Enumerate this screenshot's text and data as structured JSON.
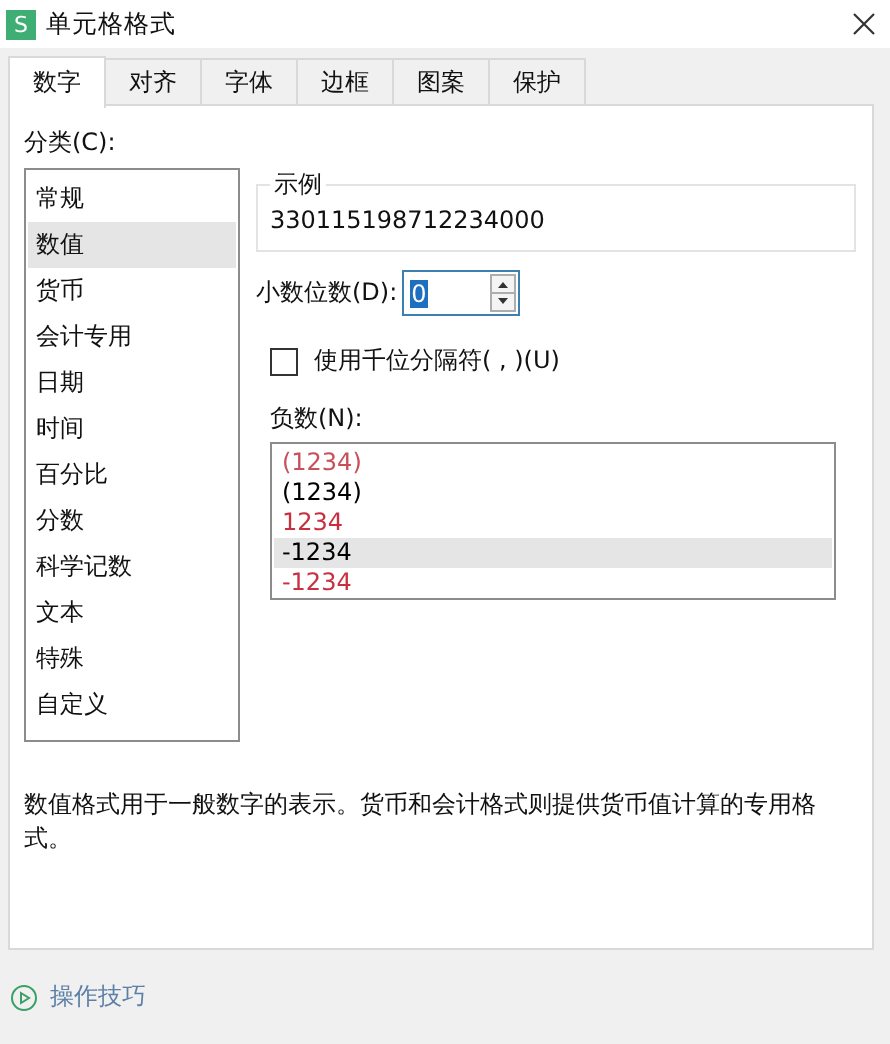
{
  "window": {
    "icon_letter": "S",
    "title": "单元格格式"
  },
  "tabs": [
    {
      "label": "数字",
      "selected": true
    },
    {
      "label": "对齐",
      "selected": false
    },
    {
      "label": "字体",
      "selected": false
    },
    {
      "label": "边框",
      "selected": false
    },
    {
      "label": "图案",
      "selected": false
    },
    {
      "label": "保护",
      "selected": false
    }
  ],
  "category": {
    "label": "分类(C):",
    "items": [
      {
        "label": "常规",
        "selected": false
      },
      {
        "label": "数值",
        "selected": true
      },
      {
        "label": "货币",
        "selected": false
      },
      {
        "label": "会计专用",
        "selected": false
      },
      {
        "label": "日期",
        "selected": false
      },
      {
        "label": "时间",
        "selected": false
      },
      {
        "label": "百分比",
        "selected": false
      },
      {
        "label": "分数",
        "selected": false
      },
      {
        "label": "科学记数",
        "selected": false
      },
      {
        "label": "文本",
        "selected": false
      },
      {
        "label": "特殊",
        "selected": false
      },
      {
        "label": "自定义",
        "selected": false
      }
    ]
  },
  "sample": {
    "label": "示例",
    "value": "330115198712234000"
  },
  "decimal_places": {
    "label": "小数位数(D):",
    "value": "0"
  },
  "thousands_separator": {
    "label": "使用千位分隔符( , )(U)",
    "checked": false
  },
  "negative_numbers": {
    "label": "负数(N):",
    "items": [
      {
        "text": "(1234)",
        "color": "#c8505a",
        "selected": false
      },
      {
        "text": "(1234)",
        "color": "#000000",
        "selected": false
      },
      {
        "text": "1234",
        "color": "#c83040",
        "selected": false
      },
      {
        "text": "-1234",
        "color": "#000000",
        "selected": true
      },
      {
        "text": "-1234",
        "color": "#c83040",
        "selected": false
      }
    ]
  },
  "description": "数值格式用于一般数字的表示。货币和会计格式则提供货币值计算的专用格式。",
  "footer": {
    "link": "操作技巧"
  }
}
